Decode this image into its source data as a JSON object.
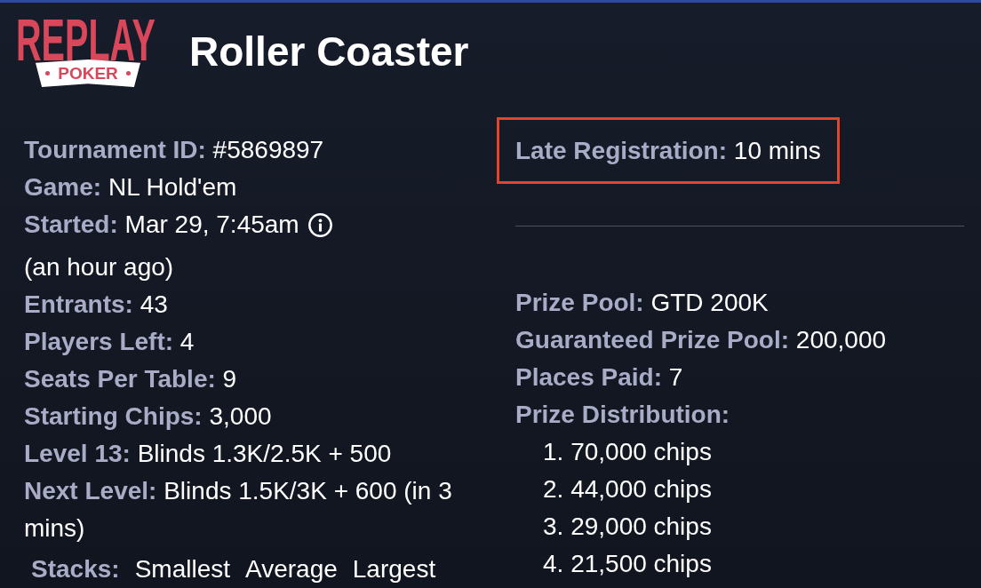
{
  "logo": {
    "wordmark": "REPLAY",
    "ribbon": "POKER"
  },
  "title": "Roller Coaster",
  "details": [
    {
      "label": "Tournament ID:",
      "value": "#5869897"
    },
    {
      "label": "Game:",
      "value": "NL Hold'em"
    },
    {
      "label": "Started:",
      "value": "Mar 29, 7:45am",
      "info_button": true,
      "note": "(an hour ago)"
    },
    {
      "label": "Entrants:",
      "value": "43"
    },
    {
      "label": "Players Left:",
      "value": "4"
    },
    {
      "label": "Seats Per Table:",
      "value": "9"
    },
    {
      "label": "Starting Chips:",
      "value": "3,000"
    },
    {
      "label": "Level 13:",
      "value": "Blinds 1.3K/2.5K + 500"
    },
    {
      "label": "Next Level:",
      "value": "Blinds 1.5K/3K + 600 (in 3 mins)"
    }
  ],
  "stacks": {
    "label": "Stacks:",
    "columns": [
      "Smallest",
      "Average",
      "Largest"
    ]
  },
  "late_registration": {
    "label": "Late Registration:",
    "value": "10 mins",
    "highlighted": true
  },
  "prizes": [
    {
      "label": "Prize Pool:",
      "value": "GTD 200K"
    },
    {
      "label": "Guaranteed Prize Pool:",
      "value": "200,000"
    },
    {
      "label": "Places Paid:",
      "value": "7"
    }
  ],
  "prize_distribution": {
    "label": "Prize Distribution:",
    "items": [
      "1. 70,000 chips",
      "2. 44,000 chips",
      "3. 29,000 chips",
      "4. 21,500 chips"
    ]
  }
}
